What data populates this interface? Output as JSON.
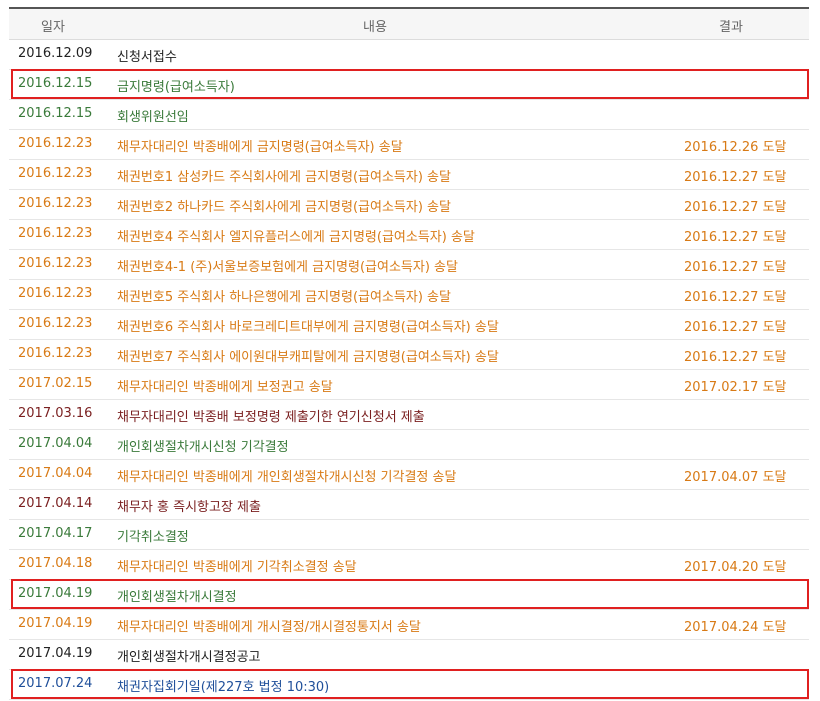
{
  "table": {
    "headers": {
      "date": "일자",
      "content": "내용",
      "result": "결과"
    },
    "rows": [
      {
        "date": "2016.12.09",
        "content": "신청서접수",
        "result": "",
        "color": "black"
      },
      {
        "date": "2016.12.15",
        "content": "금지명령(급여소득자)",
        "result": "",
        "color": "green"
      },
      {
        "date": "2016.12.15",
        "content": "회생위원선임",
        "result": "",
        "color": "green"
      },
      {
        "date": "2016.12.23",
        "content": "채무자대리인 박종배에게 금지명령(급여소득자) 송달",
        "result": "2016.12.26 도달",
        "color": "orange"
      },
      {
        "date": "2016.12.23",
        "content": "채권번호1 삼성카드 주식회사에게 금지명령(급여소득자) 송달",
        "result": "2016.12.27 도달",
        "color": "orange"
      },
      {
        "date": "2016.12.23",
        "content": "채권번호2 하나카드 주식회사에게 금지명령(급여소득자) 송달",
        "result": "2016.12.27 도달",
        "color": "orange"
      },
      {
        "date": "2016.12.23",
        "content": "채권번호4 주식회사 엘지유플러스에게 금지명령(급여소득자) 송달",
        "result": "2016.12.27 도달",
        "color": "orange"
      },
      {
        "date": "2016.12.23",
        "content": "채권번호4-1 (주)서울보증보험에게 금지명령(급여소득자) 송달",
        "result": "2016.12.27 도달",
        "color": "orange"
      },
      {
        "date": "2016.12.23",
        "content": "채권번호5 주식회사 하나은행에게 금지명령(급여소득자) 송달",
        "result": "2016.12.27 도달",
        "color": "orange"
      },
      {
        "date": "2016.12.23",
        "content": "채권번호6 주식회사 바로크레디트대부에게 금지명령(급여소득자) 송달",
        "result": "2016.12.27 도달",
        "color": "orange"
      },
      {
        "date": "2016.12.23",
        "content": "채권번호7 주식회사 에이원대부캐피탈에게 금지명령(급여소득자) 송달",
        "result": "2016.12.27 도달",
        "color": "orange"
      },
      {
        "date": "2017.02.15",
        "content": "채무자대리인 박종배에게 보정권고 송달",
        "result": "2017.02.17 도달",
        "color": "orange"
      },
      {
        "date": "2017.03.16",
        "content": "채무자대리인 박종배 보정명령 제출기한 연기신청서 제출",
        "result": "",
        "color": "maroon"
      },
      {
        "date": "2017.04.04",
        "content": "개인회생절차개시신청 기각결정",
        "result": "",
        "color": "green"
      },
      {
        "date": "2017.04.04",
        "content": "채무자대리인 박종배에게 개인회생절차개시신청 기각결정 송달",
        "result": "2017.04.07 도달",
        "color": "orange"
      },
      {
        "date": "2017.04.14",
        "content": "채무자 홍      즉시항고장 제출",
        "result": "",
        "color": "maroon"
      },
      {
        "date": "2017.04.17",
        "content": "기각취소결정",
        "result": "",
        "color": "green"
      },
      {
        "date": "2017.04.18",
        "content": "채무자대리인 박종배에게 기각취소결정 송달",
        "result": "2017.04.20 도달",
        "color": "orange"
      },
      {
        "date": "2017.04.19",
        "content": "개인회생절차개시결정",
        "result": "",
        "color": "green"
      },
      {
        "date": "2017.04.19",
        "content": "채무자대리인 박종배에게 개시결정/개시결정통지서 송달",
        "result": "2017.04.24 도달",
        "color": "orange"
      },
      {
        "date": "2017.04.19",
        "content": "개인회생절차개시결정공고",
        "result": "",
        "color": "black"
      },
      {
        "date": "2017.07.24",
        "content": "채권자집회기일(제227호 법정 10:30)",
        "result": "",
        "color": "blue"
      }
    ]
  },
  "highlight_color": "#e02020",
  "highlighted_rows": [
    1,
    18,
    21
  ]
}
